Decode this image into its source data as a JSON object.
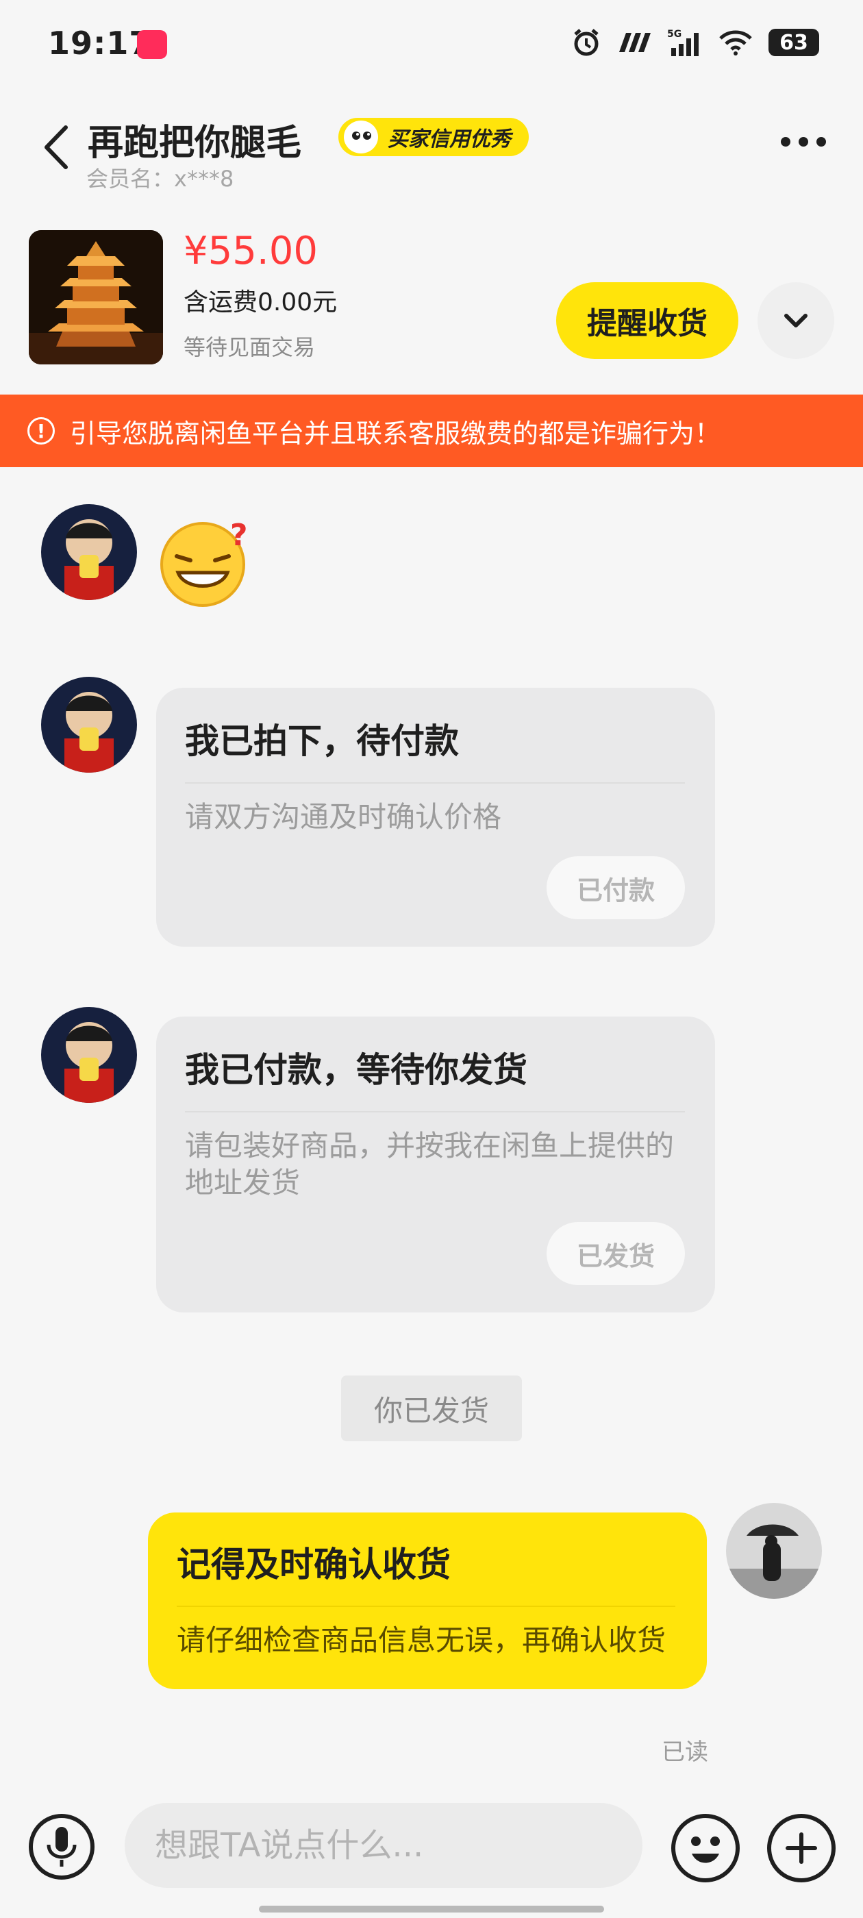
{
  "status_bar": {
    "time": "19:17",
    "battery": "63",
    "network": "5G"
  },
  "header": {
    "title": "再跑把你腿毛",
    "badge": "买家信用优秀",
    "member_label": "会员名：x***8"
  },
  "product": {
    "price": "¥55.00",
    "shipping": "含运费0.00元",
    "status": "等待见面交易",
    "remind_button": "提醒收货"
  },
  "warning": {
    "text": "引导您脱离闲鱼平台并且联系客服缴费的都是诈骗行为！"
  },
  "messages": [
    {
      "type": "emoji",
      "icon": "grin-sweat-question-emoji"
    },
    {
      "type": "card",
      "title": "我已拍下，待付款",
      "desc": "请双方沟通及时确认价格",
      "button": "已付款"
    },
    {
      "type": "card",
      "title": "我已付款，等待你发货",
      "desc": "请包装好商品，并按我在闲鱼上提供的地址发货",
      "button": "已发货"
    },
    {
      "type": "system",
      "text": "你已发货"
    },
    {
      "type": "card",
      "title": "记得及时确认收货",
      "desc": "请仔细检查商品信息无误，再确认收货",
      "read": "已读"
    }
  ],
  "input": {
    "placeholder": "想跟TA说点什么..."
  },
  "colors": {
    "accent_yellow": "#ffe40b",
    "warning_orange": "#ff5a23",
    "price_red": "#ff3b3b"
  }
}
